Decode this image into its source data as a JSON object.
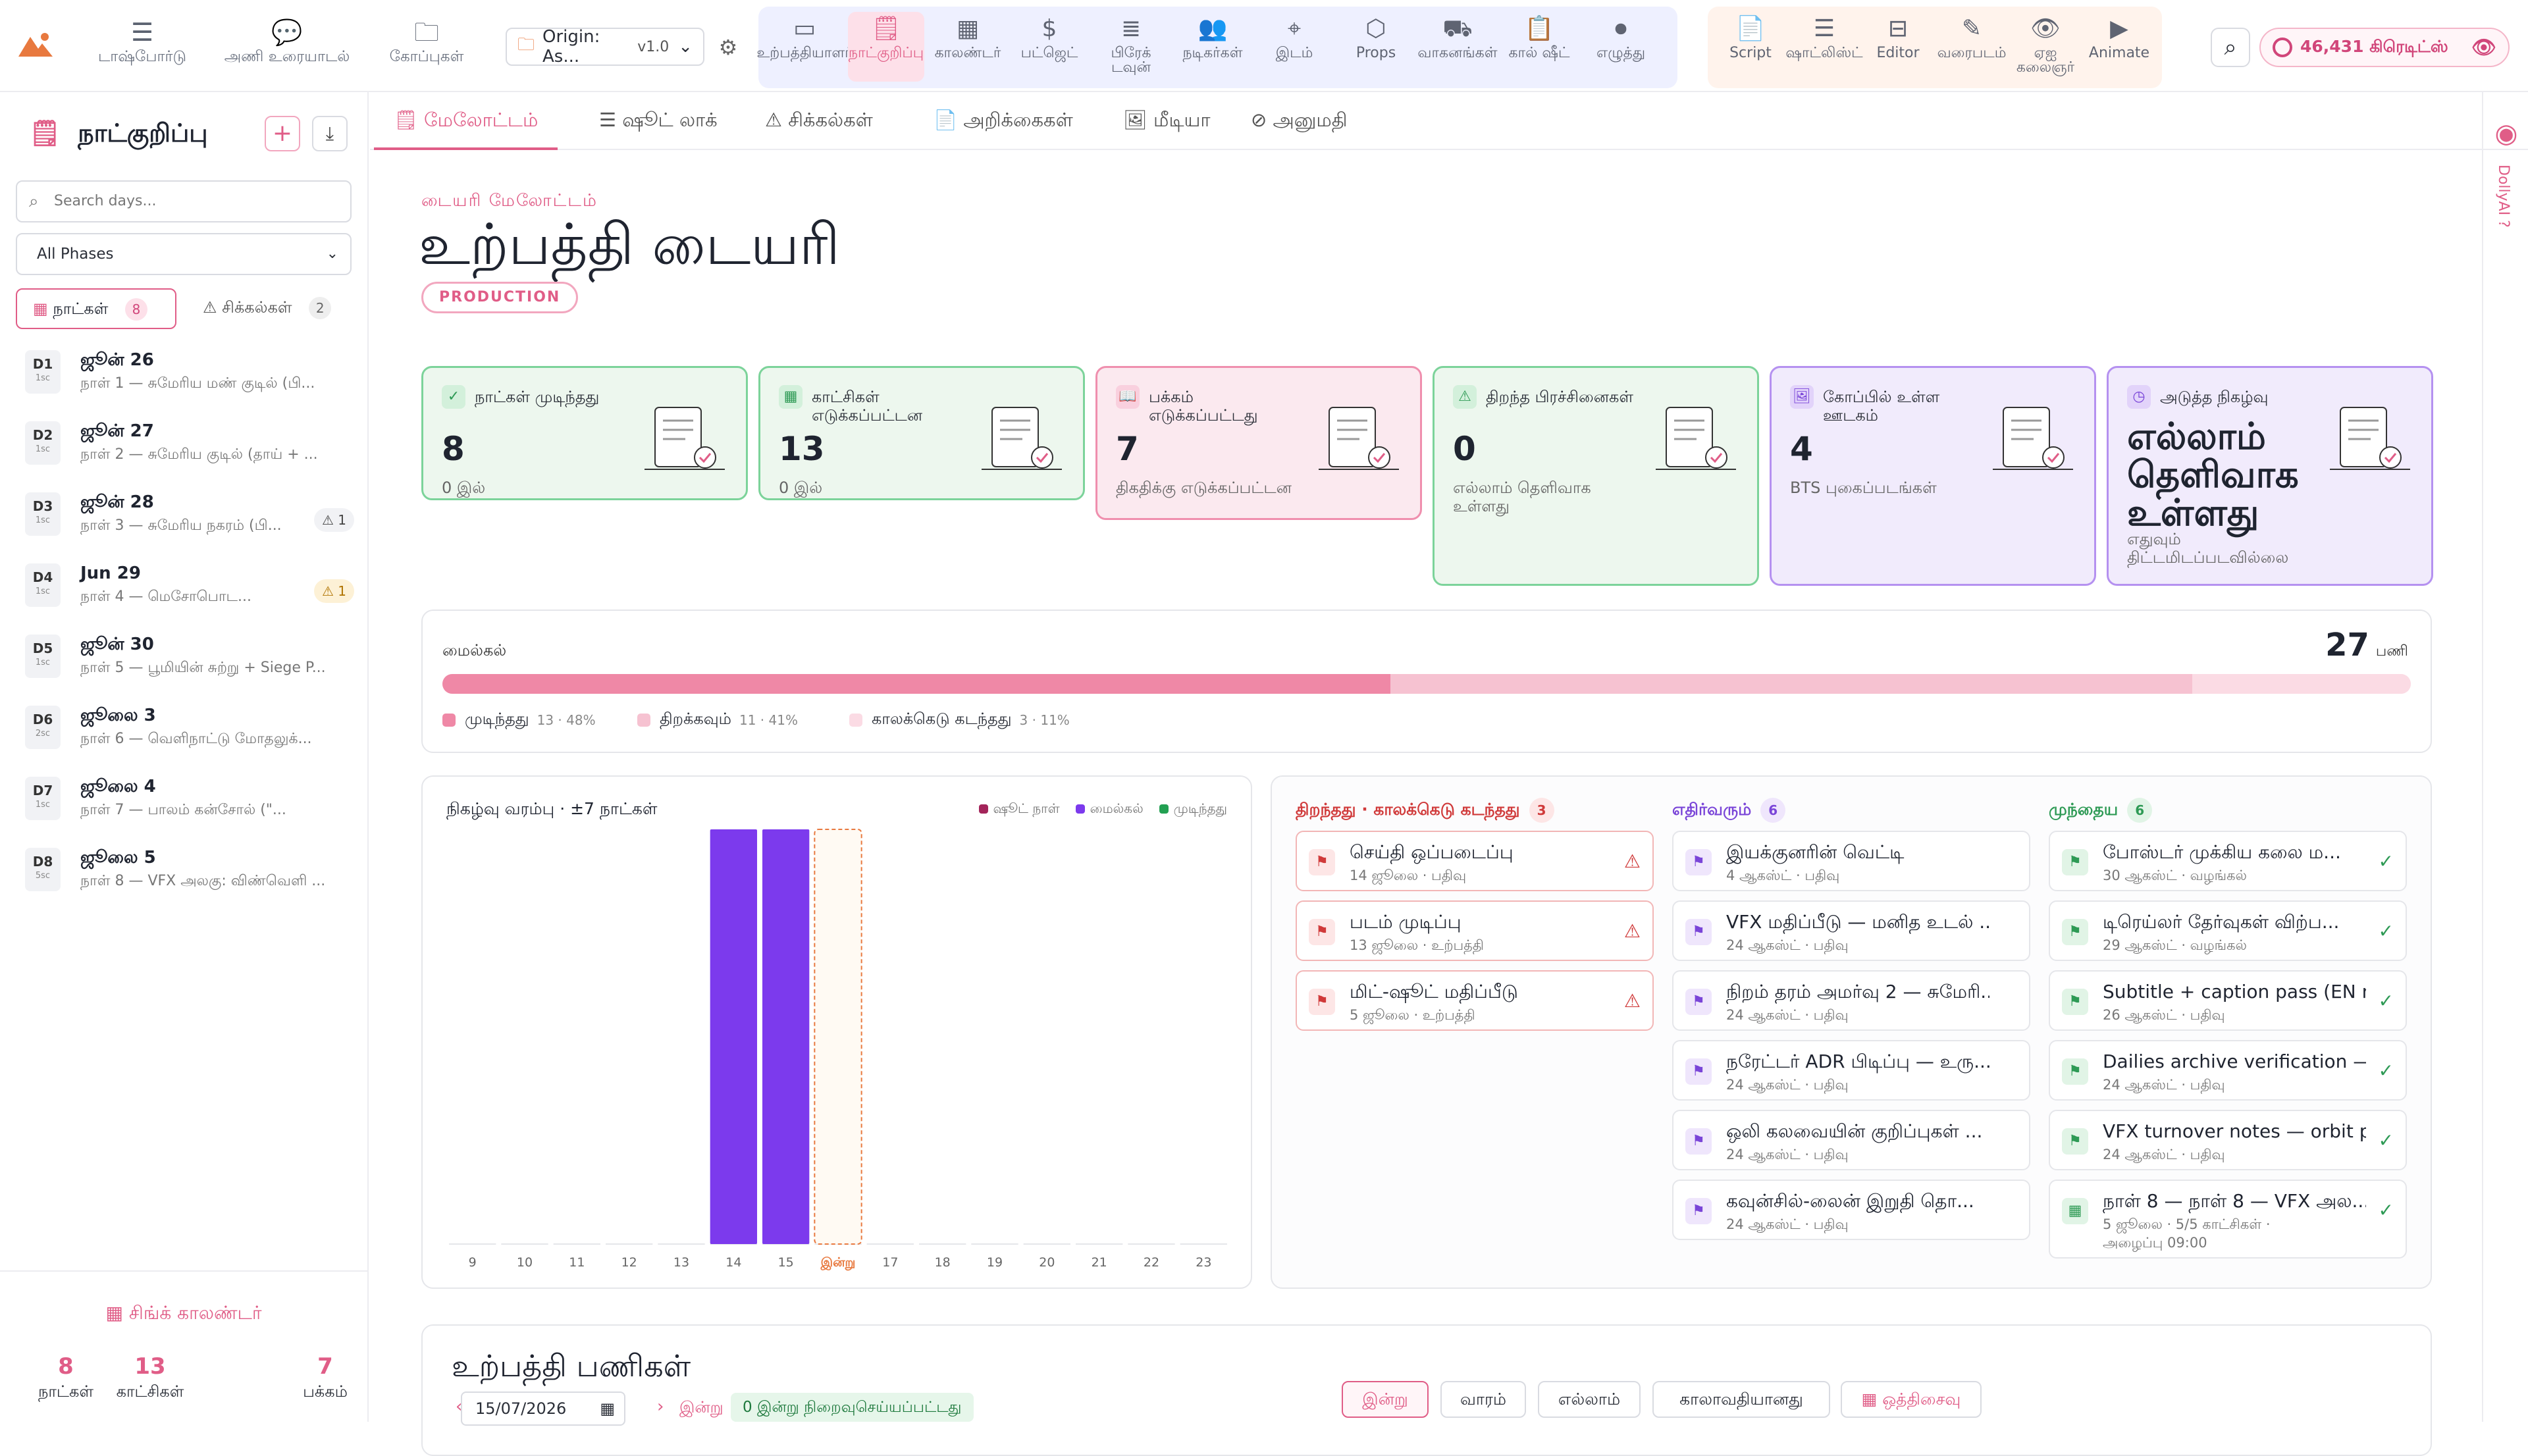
{
  "topnav": {
    "items": [
      {
        "icon": "dashboard-icon",
        "label": "டாஷ்போர்டு"
      },
      {
        "icon": "chat-icon",
        "label": "அணி உரையாடல்"
      },
      {
        "icon": "folder-icon",
        "label": "கோப்புகள்"
      }
    ],
    "project": {
      "name": "Origin: As...",
      "version": "v1.0"
    },
    "production_tools": [
      {
        "label": "உற்பத்தியாளர்",
        "icon": "producer-icon"
      },
      {
        "label": "நாட்குறிப்பு",
        "icon": "diary-icon"
      },
      {
        "label": "காலண்டர்",
        "icon": "calendar-icon"
      },
      {
        "label": "பட்ஜெட்",
        "icon": "dollar-icon"
      },
      {
        "label": "பிரேக் டவுன்",
        "icon": "breakdown-icon"
      },
      {
        "label": "நடிகர்கள்",
        "icon": "cast-icon"
      },
      {
        "label": "இடம்",
        "icon": "location-icon"
      },
      {
        "label": "Props",
        "icon": "props-icon"
      },
      {
        "label": "வாகனங்கள்",
        "icon": "vehicle-icon"
      },
      {
        "label": "கால் ஷீட்",
        "icon": "callsheet-icon"
      },
      {
        "label": "எழுத்து",
        "icon": "camera-icon"
      }
    ],
    "creative_tools": [
      {
        "label": "Script",
        "icon": "script-icon"
      },
      {
        "label": "ஷாட்லிஸ்ட்",
        "icon": "shotlist-icon"
      },
      {
        "label": "Editor",
        "icon": "editor-icon"
      },
      {
        "label": "வரைபடம்",
        "icon": "pencil-icon"
      },
      {
        "label": "ஏஐ கலைஞர்",
        "icon": "eye-icon"
      },
      {
        "label": "Animate",
        "icon": "animate-icon"
      }
    ],
    "credits": "46,431 கிரெடிட்ஸ்"
  },
  "sidebar": {
    "title": "நாட்குறிப்பு",
    "search_placeholder": "Search days...",
    "phase_select": "All Phases",
    "tabs": [
      {
        "label": "நாட்கள்",
        "count": "8"
      },
      {
        "label": "சிக்கல்கள்",
        "count": "2"
      }
    ],
    "days": [
      {
        "code": "D1",
        "sub": "1sc",
        "date": "ஜூன் 26",
        "desc": "நாள் 1 — சுமேரிய மண் குடில் (பி...",
        "warn": ""
      },
      {
        "code": "D2",
        "sub": "1sc",
        "date": "ஜூன் 27",
        "desc": "நாள் 2 — சுமேரிய குடில் (தாய் + ...",
        "warn": ""
      },
      {
        "code": "D3",
        "sub": "1sc",
        "date": "ஜூன் 28",
        "desc": "நாள் 3 — சுமேரிய நகரம் (பி...",
        "warn": "1"
      },
      {
        "code": "D4",
        "sub": "1sc",
        "date": "Jun 29",
        "desc": "நாள் 4 — மெசோபொட...",
        "warn": "1"
      },
      {
        "code": "D5",
        "sub": "1sc",
        "date": "ஜூன் 30",
        "desc": "நாள் 5 — பூமியின் சுற்று + Siege P...",
        "warn": ""
      },
      {
        "code": "D6",
        "sub": "2sc",
        "date": "ஜூலை 3",
        "desc": "நாள் 6 — வெளிநாட்டு மோதலுக்...",
        "warn": ""
      },
      {
        "code": "D7",
        "sub": "1sc",
        "date": "ஜூலை 4",
        "desc": "நாள் 7 — பாலம் கன்சோல் (\"...",
        "warn": ""
      },
      {
        "code": "D8",
        "sub": "5sc",
        "date": "ஜூலை 5",
        "desc": "நாள் 8 — VFX அலகு: விண்வெளி ...",
        "warn": ""
      }
    ],
    "sync_label": "சிங்க் காலண்டர்",
    "stats": [
      {
        "n": "8",
        "l": "நாட்கள்"
      },
      {
        "n": "13",
        "l": "காட்சிகள்"
      },
      {
        "n": "7",
        "l": "பக்கம்"
      }
    ]
  },
  "tabs": [
    {
      "label": "மேலோட்டம்",
      "icon": "document-icon"
    },
    {
      "label": "ஷூட் லாக்",
      "icon": "list-icon"
    },
    {
      "label": "சிக்கல்கள்",
      "icon": "warning-icon"
    },
    {
      "label": "அறிக்கைகள்",
      "icon": "report-icon"
    },
    {
      "label": "மீடியா",
      "icon": "image-icon"
    },
    {
      "label": "அனுமதி",
      "icon": "link-icon"
    }
  ],
  "rail_label": "DollyAI ?",
  "page": {
    "eyebrow": "டையரி மேலோட்டம்",
    "title": "உற்பத்தி டையரி",
    "badge": "PRODUCTION"
  },
  "cards": [
    {
      "label": "நாட்கள் முடிந்தது",
      "value": "8",
      "sub": "0 இல்",
      "tone": "g",
      "icon": "check-circle-icon"
    },
    {
      "label": "காட்சிகள் எடுக்கப்பட்டன",
      "value": "13",
      "sub": "0 இல்",
      "tone": "g",
      "icon": "calendar-icon"
    },
    {
      "label": "பக்கம் எடுக்கப்பட்டது",
      "value": "7",
      "sub": "திகதிக்கு எடுக்கப்பட்டன",
      "tone": "p",
      "icon": "book-icon"
    },
    {
      "label": "திறந்த பிரச்சினைகள்",
      "value": "0",
      "sub": "எல்லாம் தெளிவாக உள்ளது",
      "tone": "g",
      "icon": "warning-icon"
    },
    {
      "label": "கோப்பில் உள்ள ஊடகம்",
      "value": "4",
      "sub": "BTS புகைப்படங்கள்",
      "tone": "v",
      "icon": "image-icon"
    },
    {
      "label": "அடுத்த நிகழ்வு",
      "value": "எல்லாம் தெளிவாக உள்ளது",
      "sub": "எதுவும் திட்டமிடப்படவில்லை",
      "tone": "v",
      "icon": "clock-icon"
    }
  ],
  "milestones": {
    "label": "மைல்கல்",
    "total": "27",
    "unit": "பணி",
    "segments": [
      {
        "label": "முடிந்தது",
        "count": "13 · 48%",
        "value": 13,
        "color": "#ef88a6"
      },
      {
        "label": "திறக்கவும்",
        "count": "11 · 41%",
        "value": 11,
        "color": "#f6c2d1"
      },
      {
        "label": "காலக்கெடு கடந்தது",
        "count": "3 · 11%",
        "value": 3,
        "color": "#fbdbe4"
      }
    ]
  },
  "chart_data": {
    "type": "bar",
    "title": "நிகழ்வு வரம்பு · ±7 நாட்கள்",
    "categories": [
      "9",
      "10",
      "11",
      "12",
      "13",
      "14",
      "15",
      "இன்று",
      "17",
      "18",
      "19",
      "20",
      "21",
      "22",
      "23"
    ],
    "series": [
      {
        "name": "ஷூட் நாள்",
        "color": "#a3245a",
        "values": [
          0,
          0,
          0,
          0,
          0,
          0,
          0,
          0,
          0,
          0,
          0,
          0,
          0,
          0,
          0
        ]
      },
      {
        "name": "மைல்கல்",
        "color": "#7c3aed",
        "values": [
          0,
          0,
          0,
          0,
          0,
          1,
          1,
          0,
          0,
          0,
          0,
          0,
          0,
          0,
          0
        ]
      },
      {
        "name": "முடிந்தது",
        "color": "#22a052",
        "values": [
          0,
          0,
          0,
          0,
          0,
          0,
          0,
          0,
          0,
          0,
          0,
          0,
          0,
          0,
          0
        ]
      }
    ],
    "today_index": 7,
    "ylim": [
      0,
      1
    ]
  },
  "columns": {
    "overdue": {
      "title": "திறந்தது · காலக்கெடு கடந்தது",
      "count": "3",
      "items": [
        {
          "t": "செய்தி ஒப்படைப்பு",
          "s": "14 ஜூலை · பதிவு"
        },
        {
          "t": "படம் முடிப்பு",
          "s": "13 ஜூலை · உற்பத்தி"
        },
        {
          "t": "மிட்-ஷூட் மதிப்பீடு",
          "s": "5 ஜூலை · உற்பத்தி"
        }
      ]
    },
    "upcoming": {
      "title": "எதிர்வரும்",
      "count": "6",
      "items": [
        {
          "t": "இயக்குனரின் வெட்டி",
          "s": "4 ஆகஸ்ட் · பதிவு"
        },
        {
          "t": "VFX மதிப்பீடு — மனித உடல் ...",
          "s": "24 ஆகஸ்ட் · பதிவு"
        },
        {
          "t": "நிறம் தரம் அமர்வு 2 — சுமேரி...",
          "s": "24 ஆகஸ்ட் · பதிவு"
        },
        {
          "t": "நரேட்டர் ADR பிடிப்பு — உரு...",
          "s": "24 ஆகஸ்ட் · பதிவு"
        },
        {
          "t": "ஒலி கலவையின் குறிப்புகள் ...",
          "s": "24 ஆகஸ்ட் · பதிவு"
        },
        {
          "t": "கவுன்சில்-லைன் இறுதி தொ...",
          "s": "24 ஆகஸ்ட் · பதிவு"
        }
      ]
    },
    "previous": {
      "title": "முந்தைய",
      "count": "6",
      "items": [
        {
          "t": "போஸ்டர் முக்கிய கலை ம...",
          "s": "30 ஆகஸ்ட் · வழங்கல்"
        },
        {
          "t": "டிரெய்லர் தேர்வுகள் விற்ப...",
          "s": "29 ஆகஸ்ட் · வழங்கல்"
        },
        {
          "t": "Subtitle + caption pass (EN ma...",
          "s": "26 ஆகஸ்ட் · பதிவு"
        },
        {
          "t": "Dailies archive verification — L...",
          "s": "24 ஆகஸ்ட் · பதிவு"
        },
        {
          "t": "VFX turnover notes — orbit pl...",
          "s": "24 ஆகஸ்ட் · பதிவு"
        },
        {
          "t": "நாள் 8 — நாள் 8 — VFX அல...",
          "s": "5 ஜூலை · 5/5 காட்சிகள் ·",
          "s2": "அழைப்பு 09:00"
        }
      ]
    }
  },
  "tasks": {
    "title": "உற்பத்தி பணிகள்",
    "date": "15/07/2026",
    "today_link": "இன்று",
    "done_pill": "0 இன்று நிறைவுசெய்யப்பட்டது",
    "filters": [
      "இன்று",
      "வாரம்",
      "எல்லாம்",
      "காலாவதியானது",
      "ஒத்திசைவு"
    ]
  }
}
